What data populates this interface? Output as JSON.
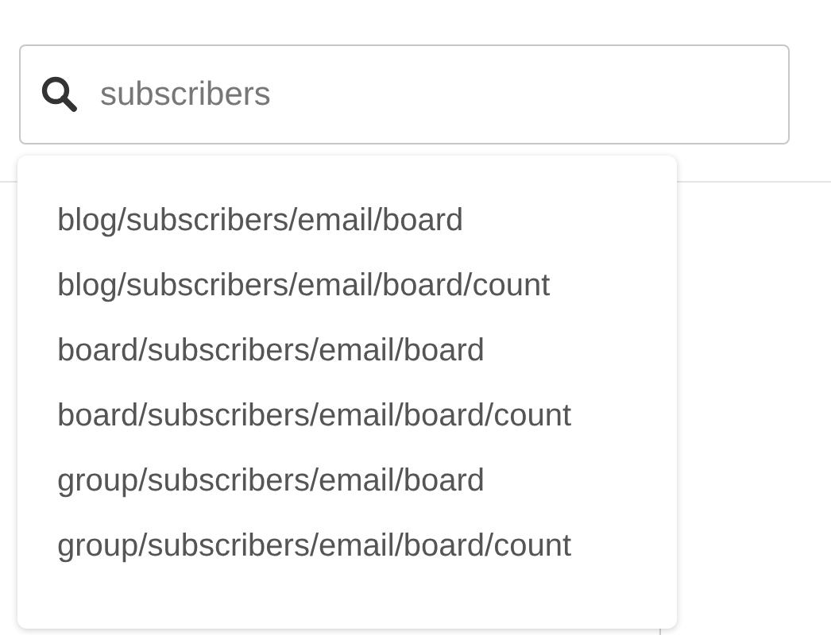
{
  "search": {
    "value": "subscribers"
  },
  "suggestions": [
    {
      "label": "blog/subscribers/email/board"
    },
    {
      "label": "blog/subscribers/email/board/count"
    },
    {
      "label": "board/subscribers/email/board"
    },
    {
      "label": "board/subscribers/email/board/count"
    },
    {
      "label": "group/subscribers/email/board"
    },
    {
      "label": "group/subscribers/email/board/count"
    }
  ]
}
